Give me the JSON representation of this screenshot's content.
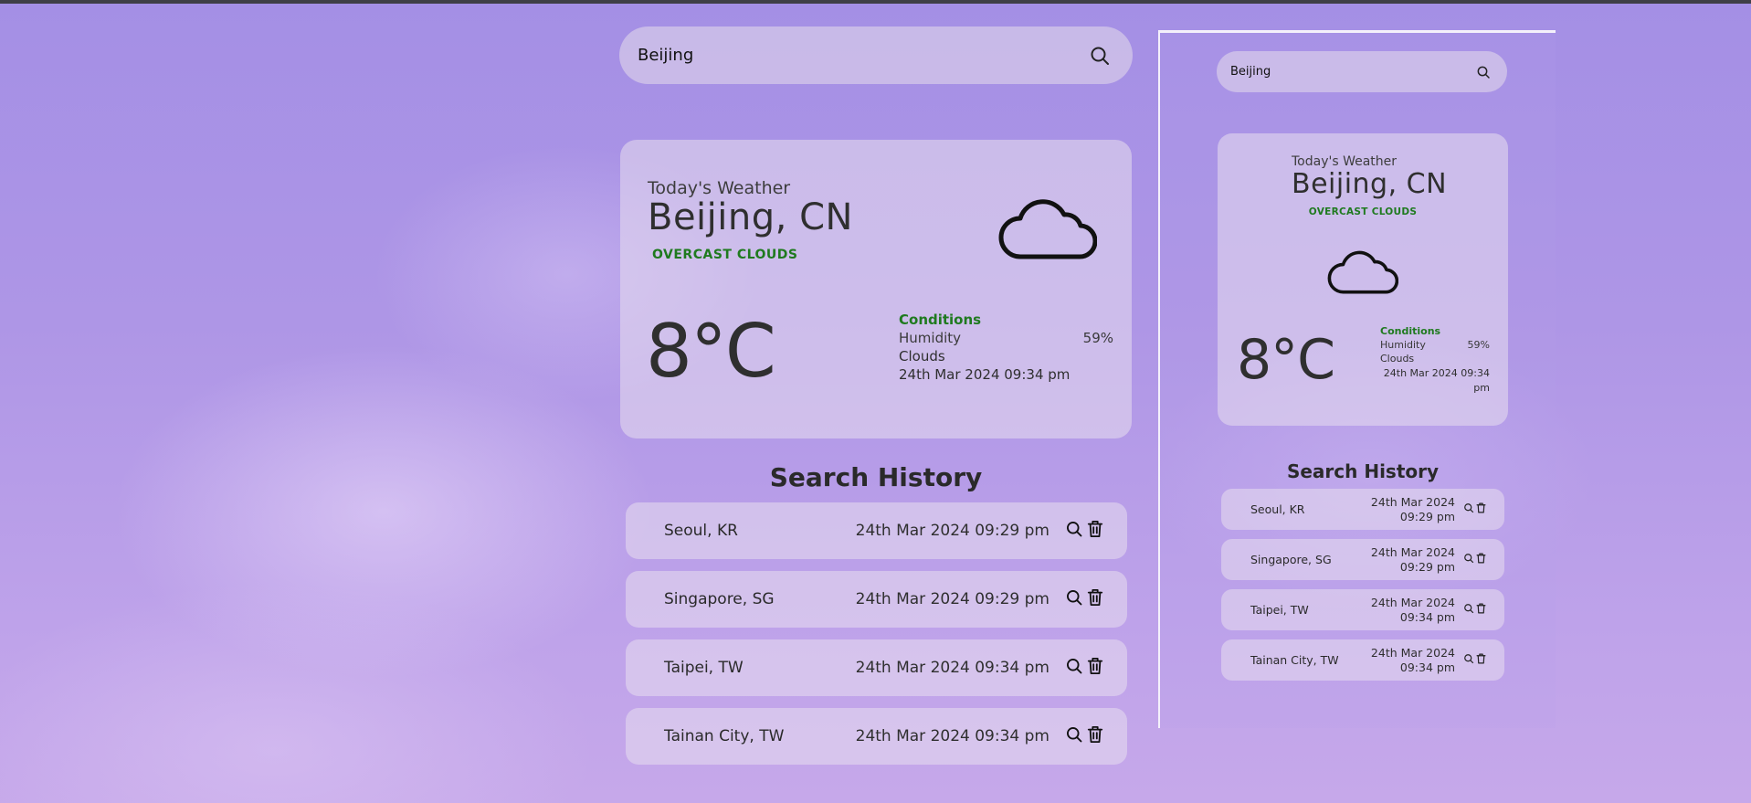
{
  "search": {
    "value": "Beijing"
  },
  "weather": {
    "label": "Today's Weather",
    "city": "Beijing, CN",
    "description": "OVERCAST CLOUDS",
    "temperature": "8°C",
    "conditions_title": "Conditions",
    "humidity_label": "Humidity",
    "humidity_value": "59%",
    "main": "Clouds",
    "time": "24th Mar 2024 09:34 pm",
    "icon": "cloud-icon"
  },
  "history": {
    "title": "Search History",
    "items": [
      {
        "city": "Seoul, KR",
        "time": "24th Mar 2024 09:29 pm"
      },
      {
        "city": "Singapore, SG",
        "time": "24th Mar 2024 09:29 pm"
      },
      {
        "city": "Taipei, TW",
        "time": "24th Mar 2024 09:34 pm"
      },
      {
        "city": "Tainan City, TW",
        "time": "24th Mar 2024 09:34 pm"
      }
    ]
  },
  "colors": {
    "accent_green": "#1f7a1f",
    "text_dark": "#2f2f2f",
    "card_bg": "rgba(232,222,238,0.55)",
    "background": "#a48fe5"
  }
}
